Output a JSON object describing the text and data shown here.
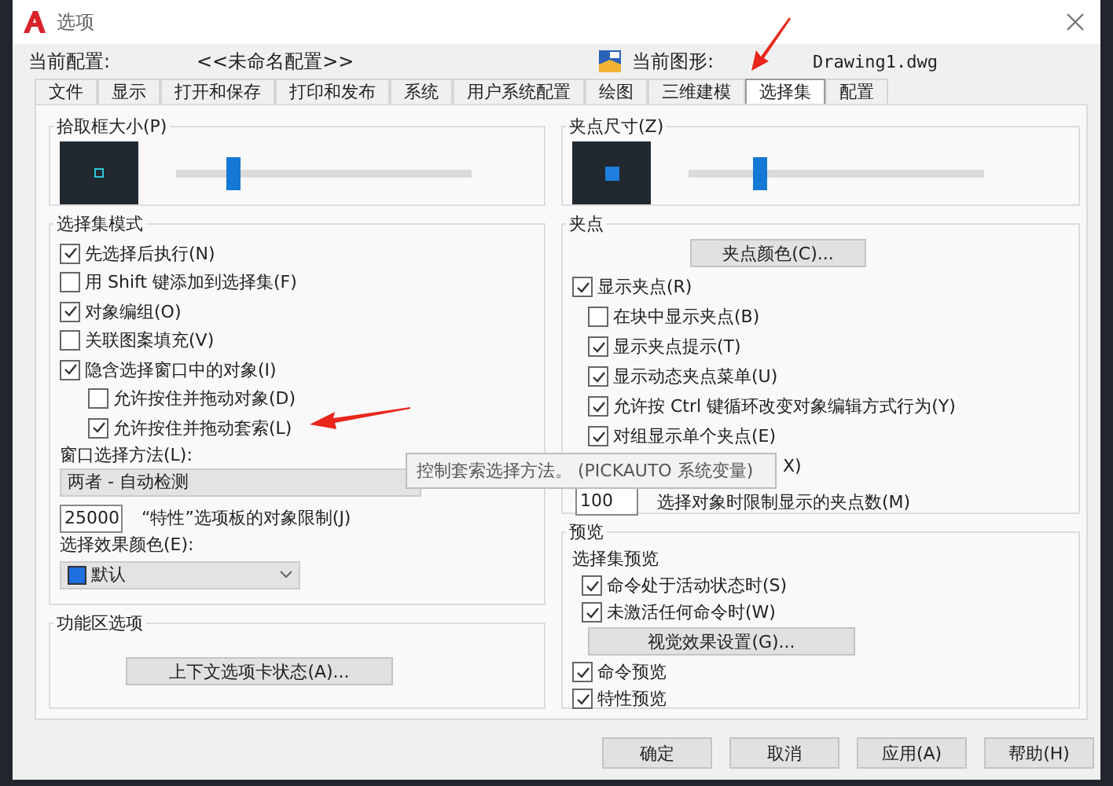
{
  "window": {
    "title": "选项"
  },
  "profile": {
    "label": "当前配置:",
    "value": "<<未命名配置>>"
  },
  "drawing": {
    "label": "当前图形:",
    "value": "Drawing1.dwg"
  },
  "tabs": [
    {
      "label": "文件",
      "selected": false
    },
    {
      "label": "显示",
      "selected": false
    },
    {
      "label": "打开和保存",
      "selected": false
    },
    {
      "label": "打印和发布",
      "selected": false
    },
    {
      "label": "系统",
      "selected": false
    },
    {
      "label": "用户系统配置",
      "selected": false
    },
    {
      "label": "绘图",
      "selected": false
    },
    {
      "label": "三维建模",
      "selected": false
    },
    {
      "label": "选择集",
      "selected": true
    },
    {
      "label": "配置",
      "selected": false
    }
  ],
  "pickbox": {
    "title": "拾取框大小(P)",
    "level": 0.17
  },
  "grip_size": {
    "title": "夹点尺寸(Z)",
    "level": 0.22
  },
  "selection_modes": {
    "title": "选择集模式",
    "items": [
      {
        "label": "先选择后执行(N)",
        "checked": true
      },
      {
        "label": "用 Shift 键添加到选择集(F)",
        "checked": false
      },
      {
        "label": "对象编组(O)",
        "checked": true
      },
      {
        "label": "关联图案填充(V)",
        "checked": false
      },
      {
        "label": "隐含选择窗口中的对象(I)",
        "checked": true,
        "children": [
          {
            "label": "允许按住并拖动对象(D)",
            "checked": false
          },
          {
            "label": "允许按住并拖动套索(L)",
            "checked": true
          }
        ]
      }
    ]
  },
  "window_method": {
    "label": "窗口选择方法(L):",
    "value": "两者 - 自动检测"
  },
  "property_limit": {
    "value": "25000",
    "label": "“特性”选项板的对象限制(J)"
  },
  "selection_color": {
    "label": "选择效果颜色(E):",
    "value": "默认"
  },
  "ribbon": {
    "title": "功能区选项",
    "button": "上下文选项卡状态(A)..."
  },
  "grips": {
    "title": "夹点",
    "button": "夹点颜色(C)...",
    "items": [
      {
        "label": "显示夹点(R)",
        "checked": true,
        "children": [
          {
            "label": "在块中显示夹点(B)",
            "checked": false
          },
          {
            "label": "显示夹点提示(T)",
            "checked": true
          },
          {
            "label": "显示动态夹点菜单(U)",
            "checked": true
          },
          {
            "label": "允许按 Ctrl 键循环改变对象编辑方式行为(Y)",
            "checked": true
          },
          {
            "label": "对组显示单个夹点(E)",
            "checked": true
          }
        ]
      }
    ],
    "covered_row_text": "X)",
    "limit": {
      "value": "100",
      "label": "选择对象时限制显示的夹点数(M)"
    }
  },
  "preview": {
    "title": "预览",
    "subtitle": "选择集预览",
    "items": [
      {
        "label": "命令处于活动状态时(S)",
        "checked": true
      },
      {
        "label": "未激活任何命令时(W)",
        "checked": true
      }
    ],
    "button": "视觉效果设置(G)...",
    "options": [
      {
        "label": "命令预览",
        "checked": true
      },
      {
        "label": "特性预览",
        "checked": true
      }
    ]
  },
  "tooltip": "控制套索选择方法。 (PICKAUTO 系统变量)",
  "buttons": [
    "确定",
    "取消",
    "应用(A)",
    "帮助(H)"
  ]
}
